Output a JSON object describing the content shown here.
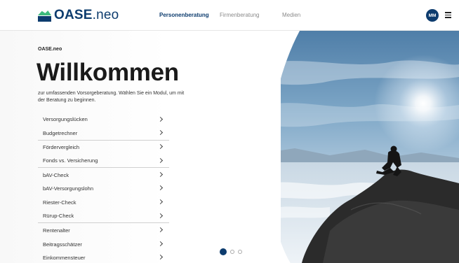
{
  "header": {
    "logo_bold": "OASE",
    "logo_light": ".neo",
    "nav": [
      {
        "label": "Personenberatung",
        "active": true
      },
      {
        "label": "Firmenberatung",
        "active": false
      },
      {
        "label": "Medien",
        "active": false
      }
    ],
    "avatar_initials": "MM"
  },
  "main": {
    "brand": "OASE.neo",
    "title": "Willkommen",
    "subtitle": "zur umfassenden Vorsorgeberatung. Wählen Sie ein Modul, um mit der Beratung zu beginnen.",
    "modules": [
      {
        "label": "Versorgungslücken"
      },
      {
        "label": "Budgetrechner"
      },
      {
        "label": "Fördervergleich"
      },
      {
        "label": "Fonds vs. Versicherung"
      },
      {
        "label": "bAV-Check"
      },
      {
        "label": "bAV-Versorgungslohn"
      },
      {
        "label": "Riester-Check"
      },
      {
        "label": "Rürup-Check"
      },
      {
        "label": "Rentenalter"
      },
      {
        "label": "Beitragsschätzer"
      },
      {
        "label": "Einkommensteuer"
      }
    ]
  },
  "carousel": {
    "slide_count": 3,
    "active_index": 0
  },
  "colors": {
    "brand_navy": "#0d3c6e",
    "brand_green": "#3dbb7d"
  }
}
